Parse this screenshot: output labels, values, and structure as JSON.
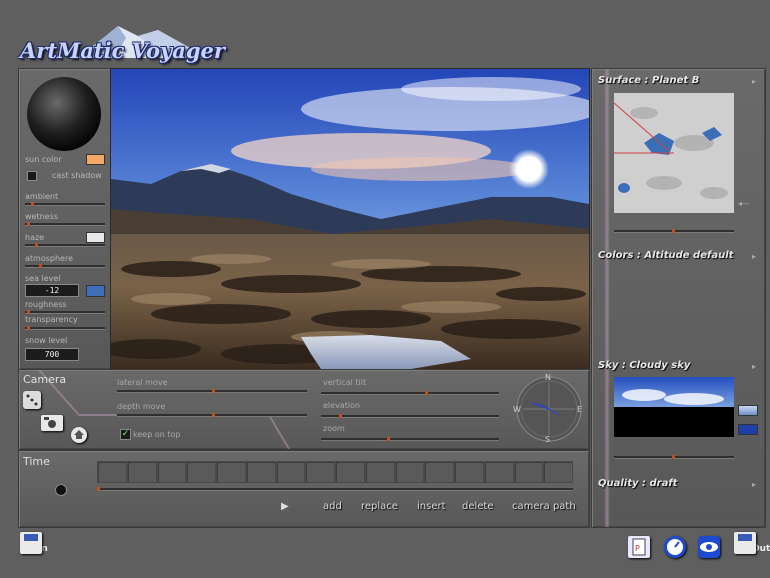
{
  "app": {
    "logo_text": "ArtMatic Voyager"
  },
  "left_panel": {
    "sun_color_label": "sun color",
    "cast_shadow_label": "cast shadow",
    "ambient_label": "ambient",
    "wetness_label": "wetness",
    "haze_label": "haze",
    "atmosphere_label": "atmosphere",
    "sea_level_label": "sea level",
    "sea_level_value": "-12",
    "roughness_label": "roughness",
    "transparency_label": "transparency",
    "snow_level_label": "snow level",
    "snow_level_value": "700",
    "colors": {
      "sun": "#f4a868",
      "haze": "#e8e8e8",
      "sea": "#3f6fb8"
    }
  },
  "camera": {
    "title": "Camera",
    "lateral_move_label": "lateral move",
    "depth_move_label": "depth move",
    "vertical_tilt_label": "vertical tilt",
    "elevation_label": "elevation",
    "zoom_label": "zoom",
    "keep_on_top_label": "keep on top",
    "keep_on_top_checked": true,
    "compass": {
      "n": "N",
      "s": "S",
      "e": "E",
      "w": "W"
    }
  },
  "time": {
    "title": "Time",
    "buttons": {
      "add": "add",
      "replace": "replace",
      "insert": "insert",
      "delete": "delete",
      "camera_path": "camera path"
    }
  },
  "right_panel": {
    "surface_title": "Surface : Planet B",
    "colors_title": "Colors : Altitude default",
    "sky_title": "Sky : Cloudy sky",
    "quality_title": "Quality : draft"
  },
  "bottom": {
    "in_label": "In",
    "out_label": "Out"
  }
}
